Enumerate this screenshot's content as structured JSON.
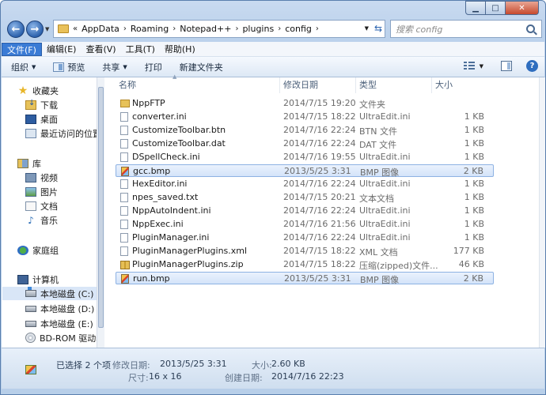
{
  "nav": {
    "breadcrumb_prefix": "«",
    "crumbs": [
      "AppData",
      "Roaming",
      "Notepad++",
      "plugins",
      "config"
    ],
    "search_placeholder": "搜索 config"
  },
  "menu": [
    "文件(F)",
    "编辑(E)",
    "查看(V)",
    "工具(T)",
    "帮助(H)"
  ],
  "toolbar": {
    "organize": "组织",
    "preview": "预览",
    "share": "共享",
    "print": "打印",
    "new_folder": "新建文件夹"
  },
  "sidebar": [
    {
      "label": "收藏夹",
      "icon": "star-icon"
    },
    {
      "label": "下载",
      "icon": "downloads-icon"
    },
    {
      "label": "桌面",
      "icon": "desktop-icon"
    },
    {
      "label": "最近访问的位置",
      "icon": "recent-places-icon"
    },
    {
      "label": "库",
      "icon": "library-icon"
    },
    {
      "label": "视频",
      "icon": "video-icon"
    },
    {
      "label": "图片",
      "icon": "pictures-icon"
    },
    {
      "label": "文档",
      "icon": "documents-icon"
    },
    {
      "label": "音乐",
      "icon": "music-icon"
    },
    {
      "label": "家庭组",
      "icon": "homegroup-icon"
    },
    {
      "label": "计算机",
      "icon": "computer-icon"
    },
    {
      "label": "本地磁盘 (C:)",
      "icon": "drive-c-icon"
    },
    {
      "label": "本地磁盘 (D:)",
      "icon": "drive-icon"
    },
    {
      "label": "本地磁盘 (E:)",
      "icon": "drive-icon"
    },
    {
      "label": "BD-ROM 驱动器",
      "icon": "disc-drive-icon"
    }
  ],
  "columns": {
    "name": "名称",
    "date": "修改日期",
    "type": "类型",
    "size": "大小"
  },
  "files": [
    {
      "name": "NppFTP",
      "date": "2014/7/15 19:20",
      "type": "文件夹",
      "size": "",
      "kind": "folder"
    },
    {
      "name": "converter.ini",
      "date": "2014/7/15 18:22",
      "type": "UltraEdit.ini",
      "size": "1 KB",
      "kind": "doc"
    },
    {
      "name": "CustomizeToolbar.btn",
      "date": "2014/7/16 22:24",
      "type": "BTN 文件",
      "size": "1 KB",
      "kind": "doc"
    },
    {
      "name": "CustomizeToolbar.dat",
      "date": "2014/7/16 22:24",
      "type": "DAT 文件",
      "size": "1 KB",
      "kind": "doc"
    },
    {
      "name": "DSpellCheck.ini",
      "date": "2014/7/16 19:55",
      "type": "UltraEdit.ini",
      "size": "1 KB",
      "kind": "doc"
    },
    {
      "name": "gcc.bmp",
      "date": "2013/5/25 3:31",
      "type": "BMP 图像",
      "size": "2 KB",
      "kind": "bmp"
    },
    {
      "name": "HexEditor.ini",
      "date": "2014/7/16 22:24",
      "type": "UltraEdit.ini",
      "size": "1 KB",
      "kind": "doc"
    },
    {
      "name": "npes_saved.txt",
      "date": "2014/7/15 20:21",
      "type": "文本文档",
      "size": "1 KB",
      "kind": "doc"
    },
    {
      "name": "NppAutoIndent.ini",
      "date": "2014/7/16 22:24",
      "type": "UltraEdit.ini",
      "size": "1 KB",
      "kind": "doc"
    },
    {
      "name": "NppExec.ini",
      "date": "2014/7/16 21:56",
      "type": "UltraEdit.ini",
      "size": "1 KB",
      "kind": "doc"
    },
    {
      "name": "PluginManager.ini",
      "date": "2014/7/16 22:24",
      "type": "UltraEdit.ini",
      "size": "1 KB",
      "kind": "doc"
    },
    {
      "name": "PluginManagerPlugins.xml",
      "date": "2014/7/15 18:22",
      "type": "XML 文档",
      "size": "177 KB",
      "kind": "doc"
    },
    {
      "name": "PluginManagerPlugins.zip",
      "date": "2014/7/15 18:22",
      "type": "压缩(zipped)文件...",
      "size": "46 KB",
      "kind": "zip"
    },
    {
      "name": "run.bmp",
      "date": "2013/5/25 3:31",
      "type": "BMP 图像",
      "size": "2 KB",
      "kind": "bmp"
    }
  ],
  "details": {
    "selection": "已选择 2 个项",
    "modified_label": "修改日期:",
    "modified_value": "2013/5/25 3:31",
    "size_label": "大小:",
    "size_value": "2.60 KB",
    "dims_label": "尺寸:",
    "dims_value": "16 x 16",
    "created_label": "创建日期:",
    "created_value": "2014/7/16 22:23"
  }
}
